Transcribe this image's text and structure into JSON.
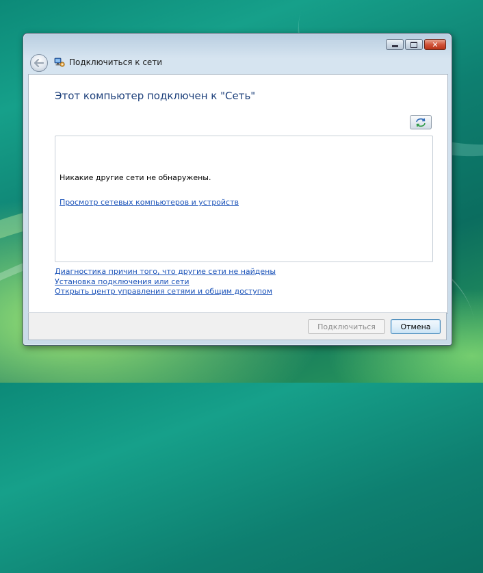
{
  "window": {
    "title": "Подключиться к сети",
    "close_symbol": "✕"
  },
  "main": {
    "heading": "Этот компьютер подключен к \"Сеть\"",
    "network_list": {
      "empty_message": "Никакие другие сети не обнаружены.",
      "view_link": "Просмотр сетевых компьютеров и устройств"
    },
    "links": [
      "Диагностика причин того, что другие сети не найдены",
      "Установка подключения или сети",
      "Открыть центр управления сетями и общим доступом"
    ]
  },
  "footer": {
    "connect_label": "Подключиться",
    "connect_enabled": false,
    "cancel_label": "Отмена"
  },
  "icons": {
    "back": "back-arrow-icon",
    "app": "network-connect-icon",
    "refresh": "refresh-icon",
    "minimize": "minimize-icon",
    "maximize": "maximize-icon",
    "close": "close-icon"
  },
  "colors": {
    "heading": "#1c3f7a",
    "link": "#1a52b8",
    "close_button": "#d2543a",
    "window_frame": "#c9dbe9"
  }
}
